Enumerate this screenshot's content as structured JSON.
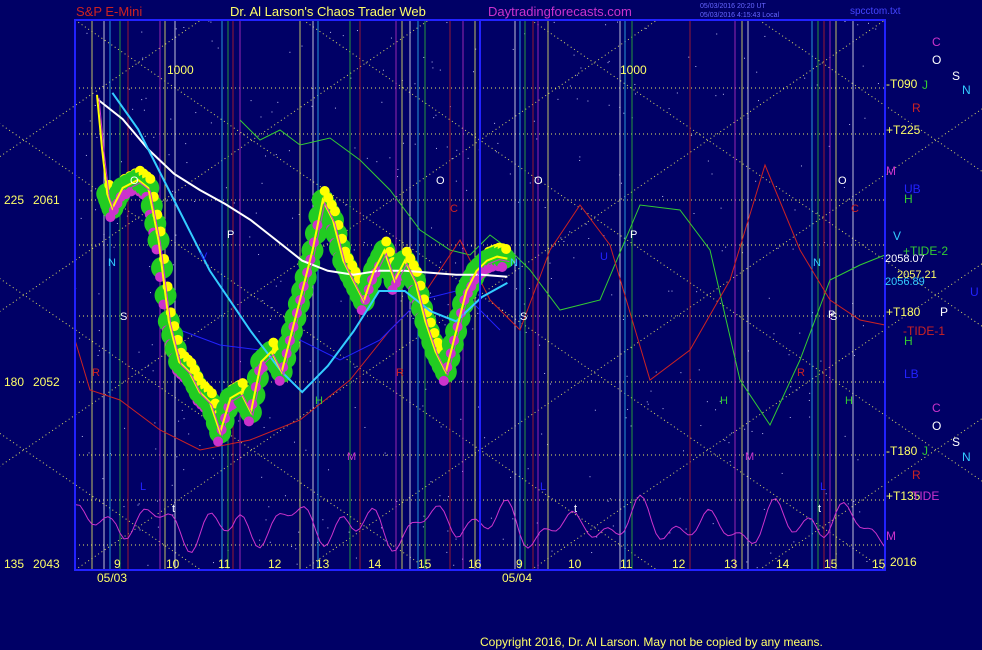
{
  "header": {
    "instrument": "S&P E-Mini",
    "title": "Dr. Al Larson's Chaos Trader Web",
    "site": "Daytradingforecasts.com",
    "timestamp1": "05/03/2016 20:20 UT",
    "timestamp2": "05/03/2016 4:15:43 Local",
    "file": "spcctom.txt"
  },
  "footer": {
    "copyright": "Copyright 2016, Dr. Al Larson. May not be copied by any means."
  },
  "colors": {
    "background": "#000066",
    "frame": "#2222ff",
    "grid_yellow": "#ffff66",
    "price_yellow": "#ffff00",
    "price_magenta": "#cc33cc",
    "fat_green": "#22cc22",
    "white_avg": "#ffffff",
    "cyan_avg": "#33ccff",
    "tide_green": "#33cc33",
    "tide_red": "#cc2222",
    "energy_magenta": "#cc33cc"
  },
  "chart_data": {
    "type": "line",
    "y_axis": {
      "ticks": [
        {
          "value": 2061,
          "angle": "225"
        },
        {
          "value": 2052,
          "angle": "180"
        },
        {
          "value": 2043,
          "angle": "135"
        }
      ],
      "ylim": [
        2043,
        2067
      ]
    },
    "x_axis": {
      "hour_ticks": [
        "9",
        "10",
        "11",
        "12",
        "13",
        "14",
        "15",
        "16",
        "9",
        "10",
        "11",
        "12",
        "13",
        "14",
        "15",
        "15"
      ],
      "date_labels": [
        "05/03",
        "05/04"
      ],
      "year": "2016"
    },
    "price_labels": [
      "2058.07",
      "2056.89",
      "2057.21"
    ],
    "top_markers": [
      "1000",
      "1000"
    ],
    "right_labels": {
      "upper": [
        "C",
        "O",
        "S",
        "N",
        "J",
        "R",
        "M",
        "H",
        "UB",
        "V"
      ],
      "lower": [
        "C",
        "O",
        "S",
        "N",
        "J",
        "R",
        "M",
        "H",
        "LB",
        "U",
        "P"
      ],
      "cross_labels": [
        "-T090",
        "+T225",
        "+TIDE-2",
        "+T180",
        "-TIDE-1",
        "-T180",
        "+T135",
        "TIDE"
      ]
    },
    "chart_letters": [
      "O",
      "O",
      "O",
      "O",
      "P",
      "P",
      "P",
      "N",
      "N",
      "N",
      "S",
      "S",
      "S",
      "H",
      "H",
      "H",
      "M",
      "M",
      "R",
      "R",
      "R",
      "C",
      "C",
      "V",
      "U",
      "L",
      "L",
      "L",
      "t",
      "t",
      "t"
    ],
    "series": [
      {
        "name": "price",
        "x": [
          0,
          0.1,
          0.2,
          0.3,
          0.5,
          0.8,
          1.0,
          1.2,
          1.4,
          1.6,
          1.8,
          2.0,
          2.2,
          2.4,
          2.6,
          2.8,
          3.0,
          3.2,
          3.4,
          3.6,
          3.8,
          4.0,
          4.2,
          4.4,
          4.6,
          4.8,
          5.0,
          5.2,
          5.4,
          5.6,
          5.8,
          6.0,
          6.2,
          6.4,
          6.6,
          6.8,
          7.0,
          7.2,
          7.4,
          7.6,
          7.8,
          8.0
        ],
        "values": [
          2066.2,
          2063.5,
          2061.3,
          2060.6,
          2061.6,
          2062.0,
          2061.6,
          2059.0,
          2055.0,
          2053.0,
          2052.5,
          2051.5,
          2051.0,
          2049.5,
          2051.2,
          2051.5,
          2050.5,
          2053.0,
          2053.5,
          2052.5,
          2054.5,
          2056.5,
          2058.5,
          2061.0,
          2060.0,
          2058.0,
          2057.0,
          2056.0,
          2057.5,
          2058.5,
          2057.0,
          2058.0,
          2057.0,
          2055.0,
          2053.5,
          2052.5,
          2054.5,
          2056.5,
          2057.5,
          2058.0,
          2058.2,
          2058.1
        ]
      },
      {
        "name": "fast average",
        "x": [
          0.3,
          0.8,
          1.5,
          2.2,
          3.0,
          3.6,
          4.0,
          4.5,
          5.0,
          5.5,
          6.0,
          6.5,
          7.0,
          7.5,
          8.0
        ],
        "values": [
          2066.3,
          2064.5,
          2061.0,
          2057.5,
          2054.5,
          2052.5,
          2051.5,
          2052.8,
          2054.5,
          2056.5,
          2056.5,
          2055.5,
          2055.0,
          2056.2,
          2056.9
        ]
      },
      {
        "name": "slow average",
        "x": [
          0.0,
          0.5,
          1.0,
          1.5,
          2.0,
          2.5,
          3.0,
          3.5,
          4.0,
          4.5,
          5.0,
          5.5,
          6.0,
          6.5,
          7.0,
          7.5,
          8.0
        ],
        "values": [
          2066.0,
          2065.0,
          2063.5,
          2062.3,
          2061.5,
          2060.8,
          2060.0,
          2059.0,
          2058.0,
          2057.5,
          2057.3,
          2057.5,
          2057.5,
          2057.4,
          2057.3,
          2057.3,
          2057.2
        ]
      }
    ]
  }
}
